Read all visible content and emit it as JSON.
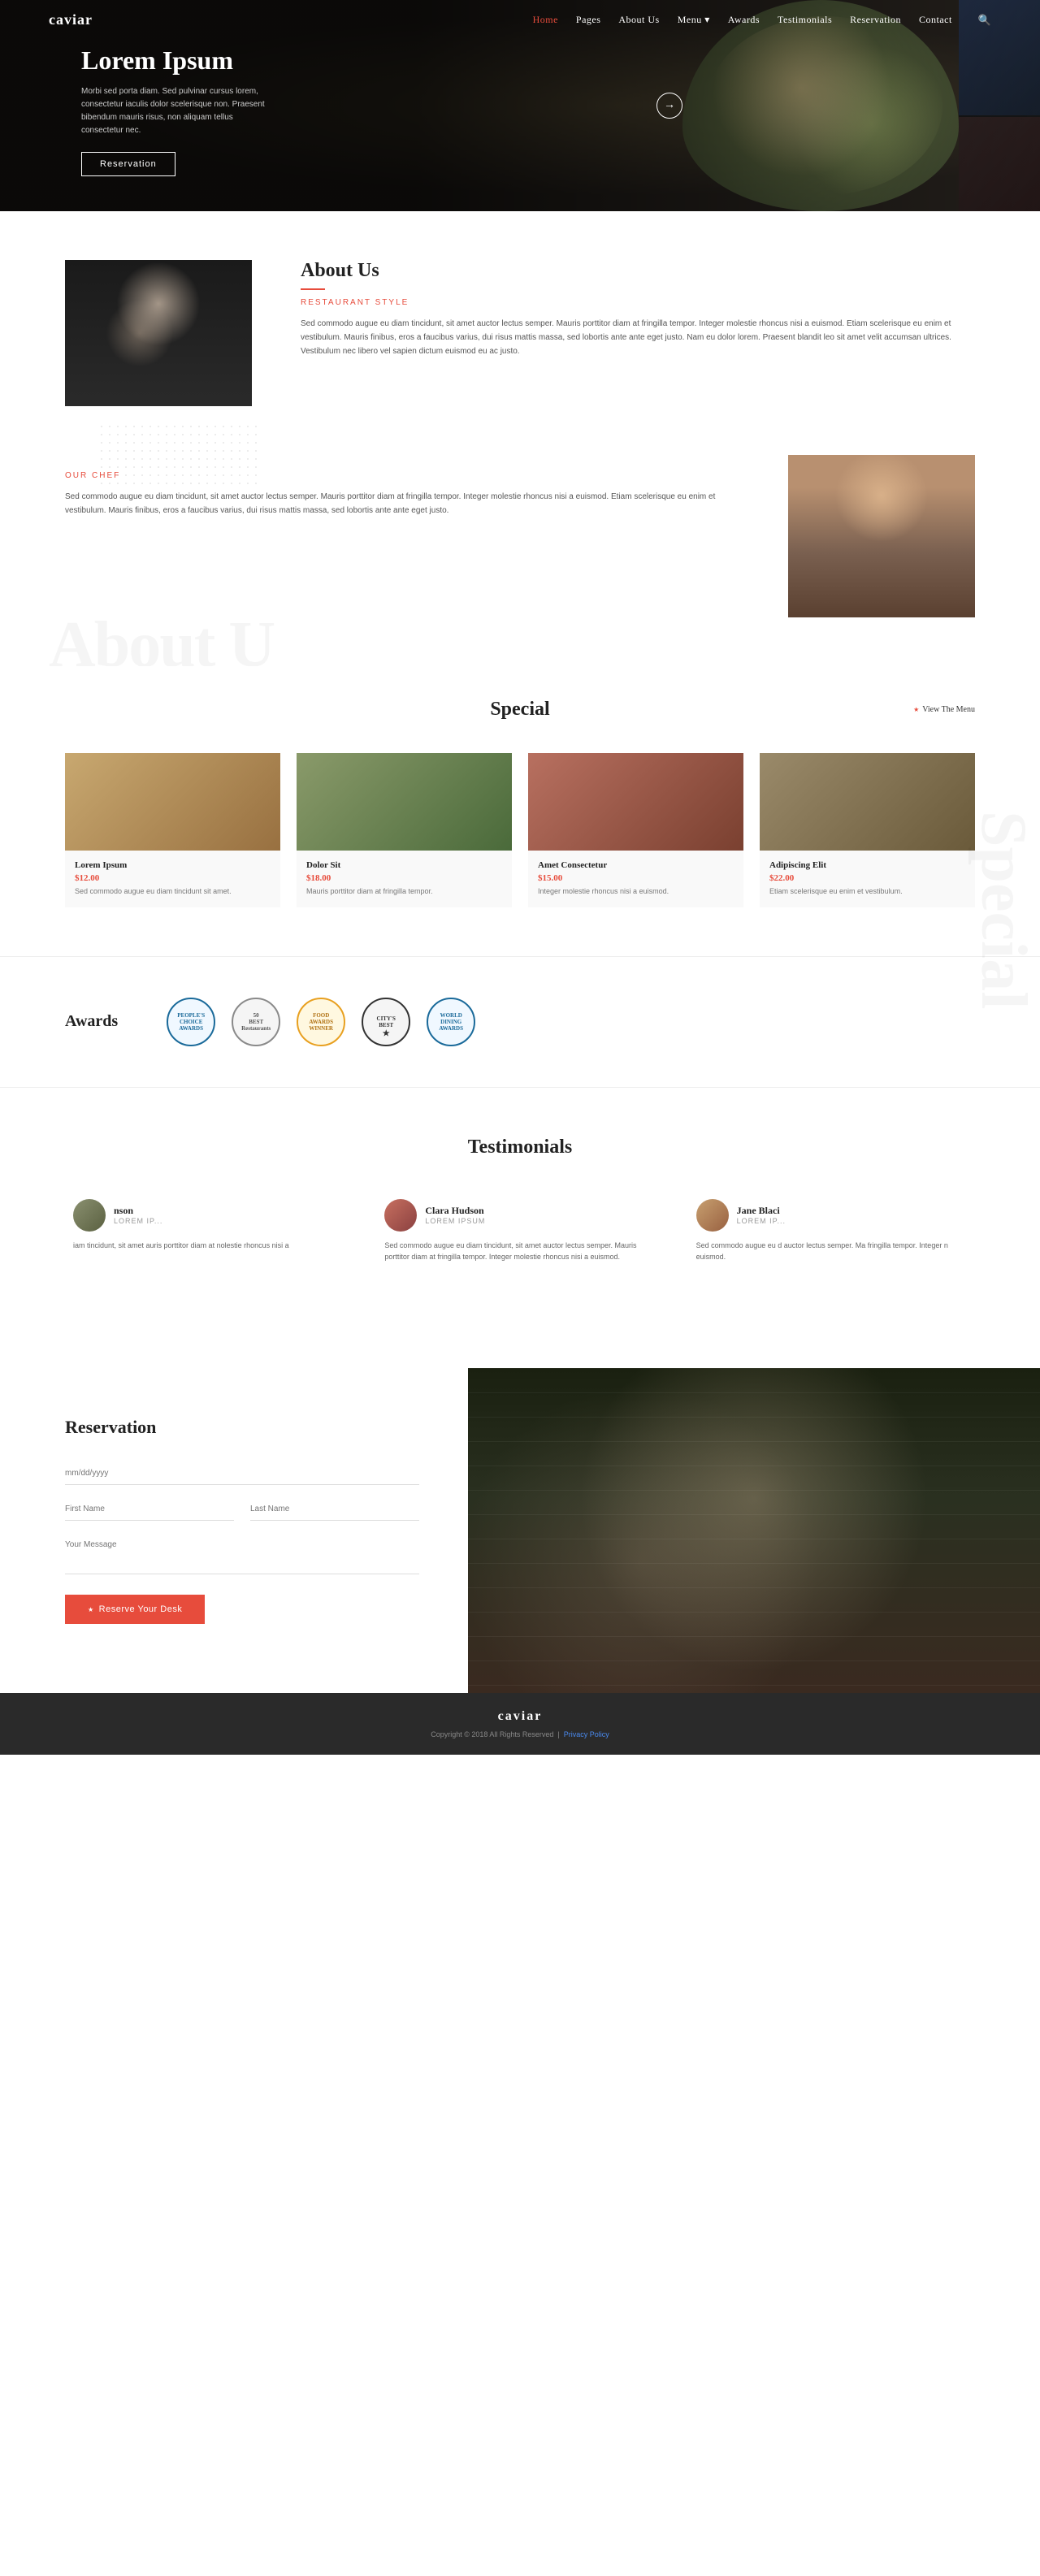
{
  "nav": {
    "logo": "caviar",
    "links": [
      "Home",
      "Pages",
      "About Us",
      "Menu",
      "Awards",
      "Testimonials",
      "Reservation",
      "Contact"
    ],
    "active": "Home",
    "search_icon": "🔍"
  },
  "hero": {
    "title": "Lorem Ipsum",
    "text": "Morbi sed porta diam. Sed pulvinar cursus lorem, consectetur iaculis dolor scelerisque non. Praesent bibendum mauris risus, non aliquam tellus consectetur nec.",
    "btn_label": "Reservation",
    "arrow": "→"
  },
  "about": {
    "title": "About Us",
    "divider": true,
    "subtitle": "RESTAURANT STYLE",
    "body": "Sed commodo augue eu diam tincidunt, sit amet auctor lectus semper. Mauris porttitor diam at fringilla tempor. Integer molestie rhoncus nisi a euismod. Etiam scelerisque eu enim et vestibulum. Mauris finibus, eros a faucibus varius, dui risus mattis massa, sed lobortis ante ante eget justo. Nam eu dolor lorem. Praesent blandit leo sit amet velit accumsan ultrices. Vestibulum nec libero vel sapien dictum euismod eu ac justo.",
    "watermark": "About U",
    "chef_subtitle": "OUR CHEF",
    "chef_body": "Sed commodo augue eu diam tincidunt, sit amet auctor lectus semper. Mauris porttitor diam at fringilla tempor. Integer molestie rhoncus nisi a euismod. Etiam scelerisque eu enim et vestibulum. Mauris finibus, eros a faucibus varius, dui risus mattis massa, sed lobortis ante ante eget justo."
  },
  "special": {
    "title": "Special",
    "view_menu_label": "View The Menu",
    "items": [
      {
        "name": "Lorem Ipsum",
        "price": "$12.00",
        "desc": "Sed commodo augue eu diam tincidunt sit amet."
      },
      {
        "name": "Dolor Sit",
        "price": "$18.00",
        "desc": "Mauris porttitor diam at fringilla tempor."
      },
      {
        "name": "Amet Consectetur",
        "price": "$15.00",
        "desc": "Integer molestie rhoncus nisi a euismod."
      },
      {
        "name": "Adipiscing Elit",
        "price": "$22.00",
        "desc": "Etiam scelerisque eu enim et vestibulum."
      }
    ],
    "side_text": "Special"
  },
  "awards": {
    "title": "Awards",
    "badges": [
      {
        "text": "PEOPLE'S\nCHOICE\nAWARDS",
        "color": "#1a6a9a"
      },
      {
        "text": "50\nBEST\nRestaurants",
        "color": "#8a8a8a"
      },
      {
        "text": "FOOD\nAWARDS\nWINNER",
        "color": "#e8a020"
      },
      {
        "text": "CITY'S\nBEST\n★",
        "color": "#333"
      },
      {
        "text": "WORLD\nDINING\nAWARDS",
        "color": "#1a6a9a"
      }
    ]
  },
  "testimonials": {
    "title": "Testimonials",
    "items": [
      {
        "name": "nson",
        "role": "LOREM IP...",
        "text": "iam tincidunt, sit amet auris porttitor diam at nolestie rhoncus nisi a",
        "avatar_type": "male-partial"
      },
      {
        "name": "Clara Hudson",
        "role": "LOREM IPSUM",
        "text": "Sed commodo augue eu diam tincidunt, sit amet auctor lectus semper. Mauris porttitor diam at fringilla tempor. Integer molestie rhoncus nisi a euismod.",
        "avatar_type": "female"
      },
      {
        "name": "Jane Blaci",
        "role": "LOREM IP...",
        "text": "Sed commodo augue eu d auctor lectus semper. Ma fringilla tempor. Integer n euismod.",
        "avatar_type": "female2"
      }
    ]
  },
  "reservation": {
    "title": "Reservation",
    "fields": {
      "date": "",
      "date_placeholder": "mm/dd/yyyy",
      "first_name": "",
      "first_name_placeholder": "First Name",
      "last_name": "",
      "last_name_placeholder": "Last Name",
      "message": "",
      "message_placeholder": "Your Message"
    },
    "btn_label": "Reserve Your Desk"
  },
  "footer": {
    "logo": "caviar",
    "copyright": "Copyright © 2018 All Rights Reserved",
    "link_text": "Privacy Policy"
  }
}
